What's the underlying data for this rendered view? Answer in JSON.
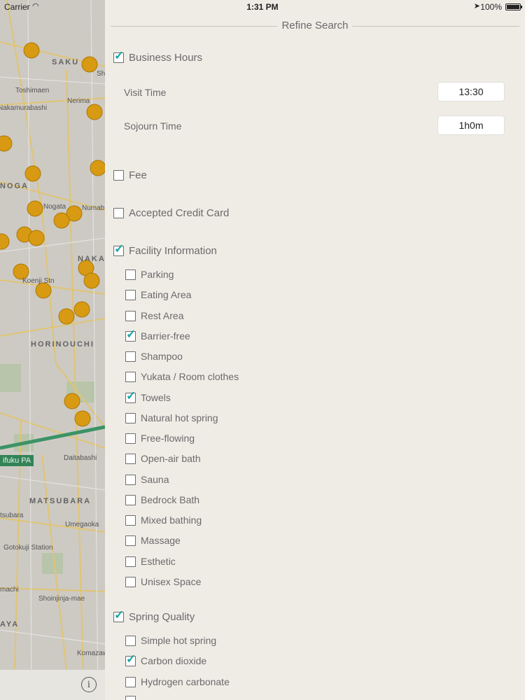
{
  "status": {
    "carrier": "Carrier",
    "time": "1:31 PM",
    "battery": "100%"
  },
  "map": {
    "labels": {
      "saku": "SAKU",
      "toshimaen": "Toshimaen",
      "nakamurabashi": "Nakamurabashi",
      "nerima": "Nerima",
      "nogata_area": "NOGA",
      "nogata": "Nogata",
      "numabe": "Numab",
      "naka": "NAKA",
      "koenji": "Koenji Stn",
      "horinouchi": "HORINOUCHI",
      "pa": "ifuku PA",
      "daitabashi": "Daitabashi",
      "matsubara": "MATSUBARA",
      "umegaoka": "Umegaoka",
      "gotokuji": "Gotokuji Station",
      "shoinjinja": "Shoinjinja-mae",
      "komazawa": "Komazawa Da",
      "aya": "AYA",
      "tsubara": "tsubara",
      "machi": "machi",
      "sh": "Sh"
    }
  },
  "panel": {
    "title": "Refine Search",
    "business_hours": {
      "label": "Business Hours",
      "visit_time_label": "Visit Time",
      "visit_time_value": "13:30",
      "sojourn_time_label": "Sojourn Time",
      "sojourn_time_value": "1h0m"
    },
    "fee": {
      "label": "Fee"
    },
    "credit": {
      "label": "Accepted Credit Card"
    },
    "facility": {
      "label": "Facility Information",
      "items": [
        {
          "label": "Parking",
          "checked": false
        },
        {
          "label": "Eating Area",
          "checked": false
        },
        {
          "label": "Rest Area",
          "checked": false
        },
        {
          "label": "Barrier-free",
          "checked": true
        },
        {
          "label": "Shampoo",
          "checked": false
        },
        {
          "label": "Yukata / Room clothes",
          "checked": false
        },
        {
          "label": "Towels",
          "checked": true
        },
        {
          "label": "Natural hot spring",
          "checked": false
        },
        {
          "label": "Free-flowing",
          "checked": false
        },
        {
          "label": "Open-air bath",
          "checked": false
        },
        {
          "label": "Sauna",
          "checked": false
        },
        {
          "label": "Bedrock Bath",
          "checked": false
        },
        {
          "label": "Mixed bathing",
          "checked": false
        },
        {
          "label": "Massage",
          "checked": false
        },
        {
          "label": "Esthetic",
          "checked": false
        },
        {
          "label": "Unisex Space",
          "checked": false
        }
      ]
    },
    "spring": {
      "label": "Spring Quality",
      "items": [
        {
          "label": "Simple hot spring",
          "checked": false
        },
        {
          "label": "Carbon dioxide",
          "checked": true
        },
        {
          "label": "Hydrogen carbonate",
          "checked": false
        }
      ]
    }
  }
}
